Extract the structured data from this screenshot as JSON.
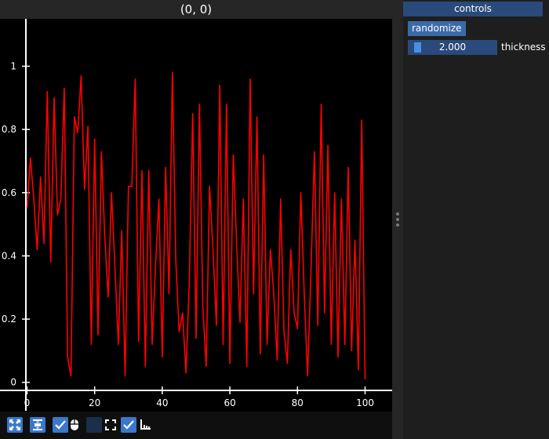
{
  "plot": {
    "title": "(0, 0)",
    "line_color": "#ff0000"
  },
  "chart_data": {
    "type": "line",
    "xlabel": "",
    "ylabel": "",
    "xlim": [
      -8,
      108
    ],
    "ylim": [
      -0.09,
      1.15
    ],
    "x_ticks": [
      0,
      20,
      40,
      60,
      80,
      100
    ],
    "y_ticks": [
      0,
      0.2,
      0.4,
      0.6,
      0.8,
      1
    ],
    "grid": false,
    "series": [
      {
        "x": [
          0,
          1,
          2,
          3,
          4,
          5,
          6,
          7,
          8,
          9,
          10,
          11,
          12,
          13,
          14,
          15,
          16,
          17,
          18,
          19,
          20,
          21,
          22,
          23,
          24,
          25,
          26,
          27,
          28,
          29,
          30,
          31,
          32,
          33,
          34,
          35,
          36,
          37,
          38,
          39,
          40,
          41,
          42,
          43,
          44,
          45,
          46,
          47,
          48,
          49,
          50,
          51,
          52,
          53,
          54,
          55,
          56,
          57,
          58,
          59,
          60,
          61,
          62,
          63,
          64,
          65,
          66,
          67,
          68,
          69,
          70,
          71,
          72,
          73,
          74,
          75,
          76,
          77,
          78,
          79,
          80,
          81,
          82,
          83,
          84,
          85,
          86,
          87,
          88,
          89,
          90,
          91,
          92,
          93,
          94,
          95,
          96,
          97,
          98,
          99,
          100
        ],
        "y": [
          0.55,
          0.71,
          0.58,
          0.42,
          0.65,
          0.44,
          0.92,
          0.38,
          0.9,
          0.53,
          0.58,
          0.93,
          0.08,
          0.02,
          0.84,
          0.79,
          0.97,
          0.61,
          0.81,
          0.12,
          0.77,
          0.15,
          0.73,
          0.46,
          0.27,
          0.6,
          0.36,
          0.12,
          0.48,
          0.02,
          0.62,
          0.62,
          0.96,
          0.13,
          0.67,
          0.05,
          0.67,
          0.12,
          0.37,
          0.58,
          0.08,
          0.68,
          0.28,
          0.98,
          0.39,
          0.16,
          0.22,
          0.03,
          0.32,
          0.85,
          0.14,
          0.88,
          0.24,
          0.05,
          0.62,
          0.42,
          0.18,
          0.94,
          0.12,
          0.88,
          0.06,
          0.72,
          0.44,
          0.19,
          0.58,
          0.05,
          0.96,
          0.28,
          0.84,
          0.09,
          0.72,
          0.12,
          0.42,
          0.28,
          0.07,
          0.58,
          0.16,
          0.06,
          0.42,
          0.22,
          0.17,
          0.6,
          0.28,
          0.02,
          0.36,
          0.73,
          0.18,
          0.88,
          0.22,
          0.75,
          0.12,
          0.6,
          0.08,
          0.58,
          0.12,
          0.68,
          0.1,
          0.45,
          0.04,
          0.83,
          0.01
        ]
      }
    ]
  },
  "toolbar": {
    "icons": [
      "fit-icon",
      "autoscale-icon",
      "check-icon",
      "mouse-icon",
      "box-icon",
      "fullscreen-icon",
      "check-icon",
      "axes-icon"
    ]
  },
  "controls": {
    "header": "controls",
    "randomize_label": "randomize",
    "thickness_value": "2.000",
    "thickness_label": "thickness",
    "thickness_fraction": 0.05
  }
}
